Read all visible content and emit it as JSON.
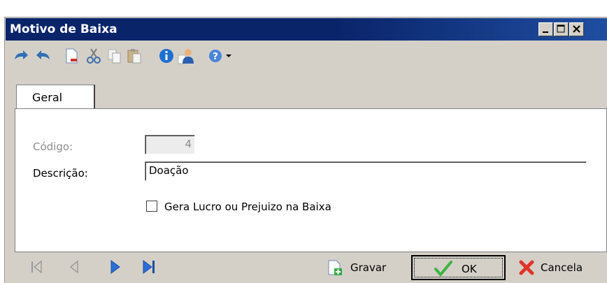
{
  "window": {
    "title": "Motivo de Baixa",
    "controls": [
      "minimize-icon",
      "maximize-icon",
      "close-icon"
    ]
  },
  "toolbar": {
    "icons": [
      "undo-icon",
      "redo-icon",
      "new-document-icon",
      "cut-icon",
      "copy-icon",
      "paste-icon",
      "info-icon",
      "user-icon",
      "help-icon",
      "dropdown-arrow-icon"
    ]
  },
  "tabs": [
    {
      "label": "Geral",
      "active": true
    }
  ],
  "form": {
    "codigo_label": "Código:",
    "codigo_value": "4",
    "descricao_label": "Descrição:",
    "descricao_value": "Doação",
    "checkbox_label": "Gera Lucro ou Prejuizo na Baixa",
    "checkbox_checked": false
  },
  "navigation": {
    "icons": [
      "first-record-icon",
      "previous-record-icon",
      "next-record-icon",
      "last-record-icon"
    ]
  },
  "buttons": {
    "gravar": "Gravar",
    "ok": "OK",
    "cancela": "Cancela"
  },
  "colors": {
    "titlebar": "#0a246a",
    "face": "#d4d0c8"
  }
}
